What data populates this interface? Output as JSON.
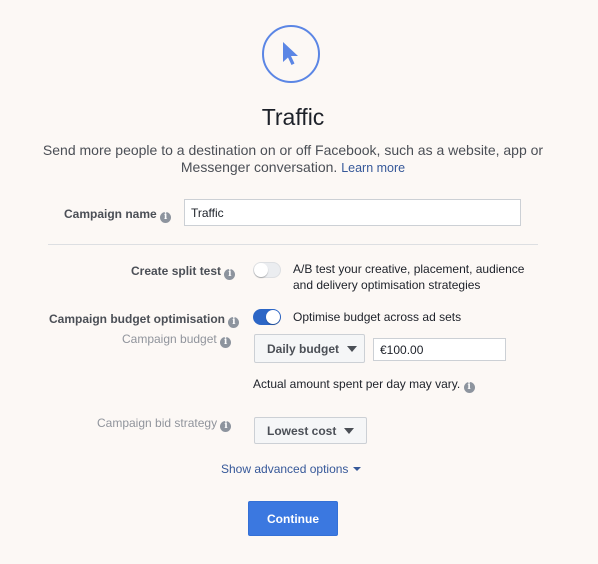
{
  "header": {
    "icon": "cursor-arrow-icon",
    "title": "Traffic",
    "description": "Send more people to a destination on or off Facebook, such as a website, app or Messenger conversation.",
    "learn_more": "Learn more"
  },
  "campaign_name": {
    "label": "Campaign name",
    "value": "Traffic"
  },
  "split_test": {
    "label": "Create split test",
    "enabled": false,
    "help_line1": "A/B test your creative, placement, audience",
    "help_line2": "and delivery optimisation strategies"
  },
  "budget_optimisation": {
    "label": "Campaign budget optimisation",
    "enabled": true,
    "toggle_text": "Optimise budget across ad sets"
  },
  "campaign_budget": {
    "label": "Campaign budget",
    "type_selected": "Daily budget",
    "amount": "€100.00",
    "note": "Actual amount spent per day may vary."
  },
  "bid_strategy": {
    "label": "Campaign bid strategy",
    "selected": "Lowest cost"
  },
  "advanced_options": "Show advanced options",
  "continue_label": "Continue",
  "colors": {
    "accent": "#3b78e0",
    "link": "#365899",
    "background": "#fcf8f5"
  }
}
